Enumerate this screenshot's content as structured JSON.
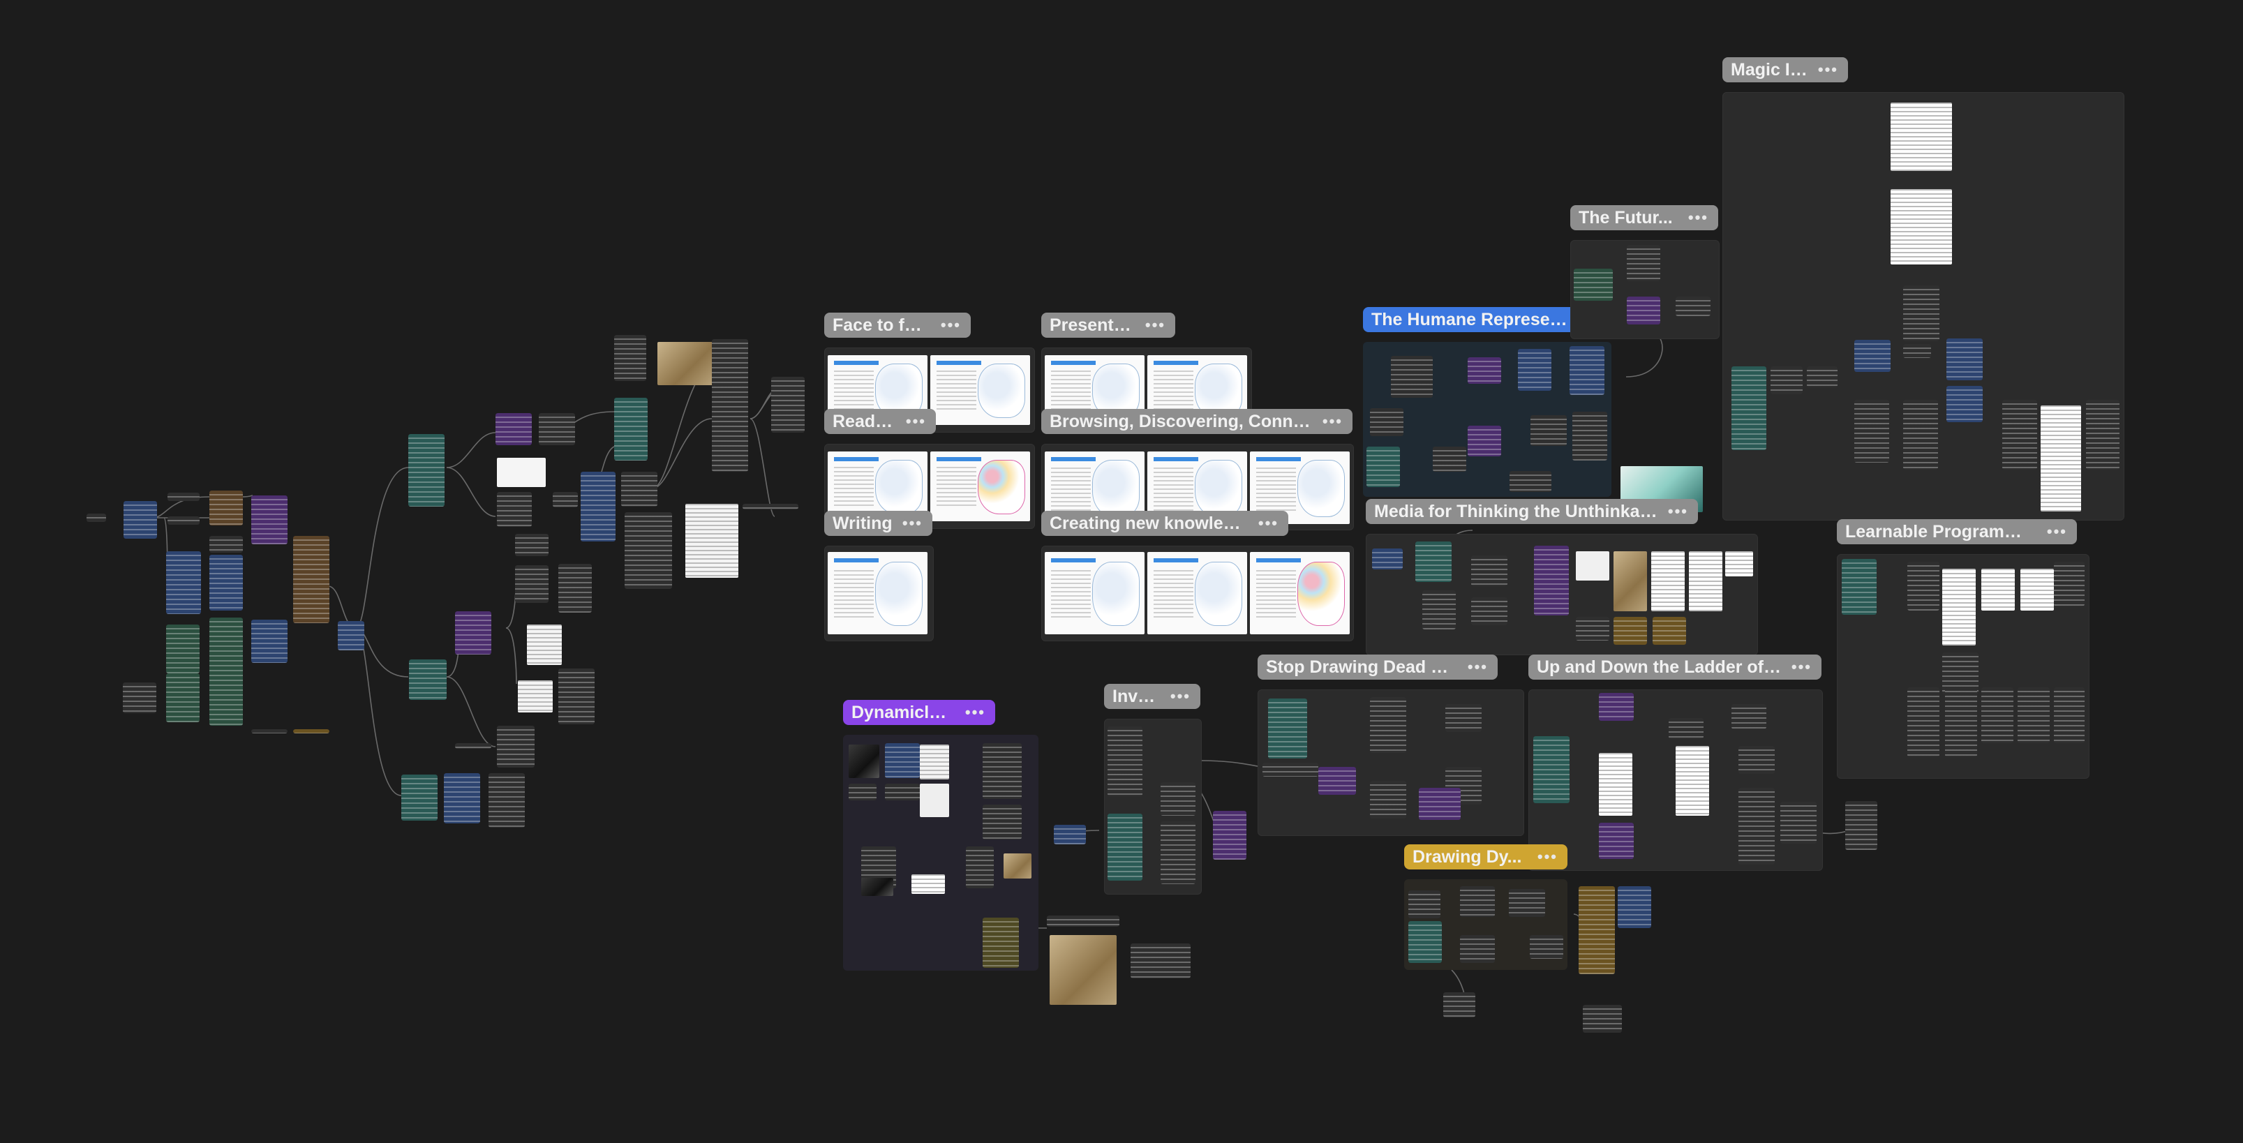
{
  "frames": {
    "magic_ink": "Magic Ink",
    "the_future": "The Futur...",
    "face_to_face": "Face to face",
    "presenting": "Presenting",
    "humane": "The Humane Represen...",
    "reading": "Reading",
    "browsing": "Browsing, Discovering, Conne...",
    "writing": "Writing",
    "creating": "Creating new knowledge",
    "media_thinking": "Media for Thinking the Unthinkable",
    "learnable": "Learnable Programming",
    "stop_drawing": "Stop Drawing Dead Fish",
    "ladder": "Up and Down the Ladder of ...",
    "dynamicland": "Dynamicland",
    "inve": "Inve...",
    "drawing_dy": "Drawing Dy..."
  },
  "ui": {
    "more_menu": "•••"
  },
  "colors": {
    "canvas": "#1c1c1c",
    "label_grey": "#8e8e8e",
    "label_blue": "#3b77e0",
    "label_purple": "#8a45e8",
    "label_gold": "#cfa531"
  }
}
